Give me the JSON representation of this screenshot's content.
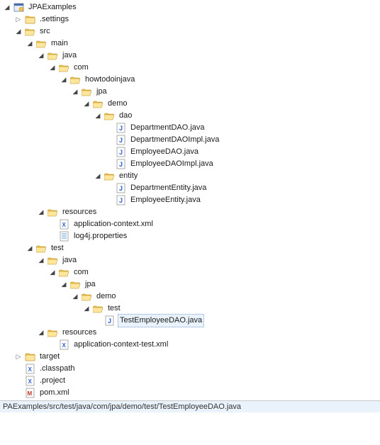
{
  "project": {
    "name": "JPAExamples",
    "settings": ".settings",
    "src": "src",
    "main": "main",
    "test": "test",
    "java": "java",
    "com": "com",
    "howtodoinjava": "howtodoinjava",
    "jpa": "jpa",
    "demo": "demo",
    "dao": "dao",
    "entity": "entity",
    "resources": "resources",
    "test_pkg": "test",
    "target": "target",
    "classpath": ".classpath",
    "projectfile": ".project",
    "pom": "pom.xml"
  },
  "files": {
    "DepartmentDAO": "DepartmentDAO.java",
    "DepartmentDAOImpl": "DepartmentDAOImpl.java",
    "EmployeeDAO": "EmployeeDAO.java",
    "EmployeeDAOImpl": "EmployeeDAOImpl.java",
    "DepartmentEntity": "DepartmentEntity.java",
    "EmployeeEntity": "EmployeeEntity.java",
    "appcontext": "application-context.xml",
    "log4j": "log4j.properties",
    "TestEmployeeDAO": "TestEmployeeDAO.java",
    "appcontext_test": "application-context-test.xml"
  },
  "status": {
    "path": "PAExamples/src/test/java/com/jpa/demo/test/TestEmployeeDAO.java"
  }
}
